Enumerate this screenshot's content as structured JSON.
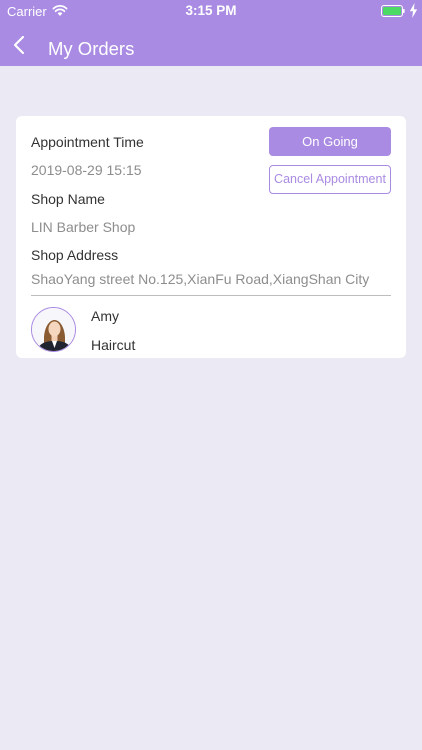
{
  "status_bar": {
    "carrier": "Carrier",
    "time": "3:15 PM"
  },
  "nav": {
    "title": "My Orders"
  },
  "colors": {
    "accent": "#a98be3",
    "background": "#ebe9f3",
    "battery": "#4cd964"
  },
  "order": {
    "appointment_time_label": "Appointment Time",
    "appointment_time": "2019-08-29 15:15",
    "shop_name_label": "Shop Name",
    "shop_name": "LIN Barber Shop",
    "shop_address_label": "Shop Address",
    "shop_address": "ShaoYang street No.125,XianFu Road,XiangShan City",
    "status": "On Going",
    "cancel_label": "Cancel Appointment",
    "stylist_name": "Amy",
    "service": "Haircut"
  }
}
